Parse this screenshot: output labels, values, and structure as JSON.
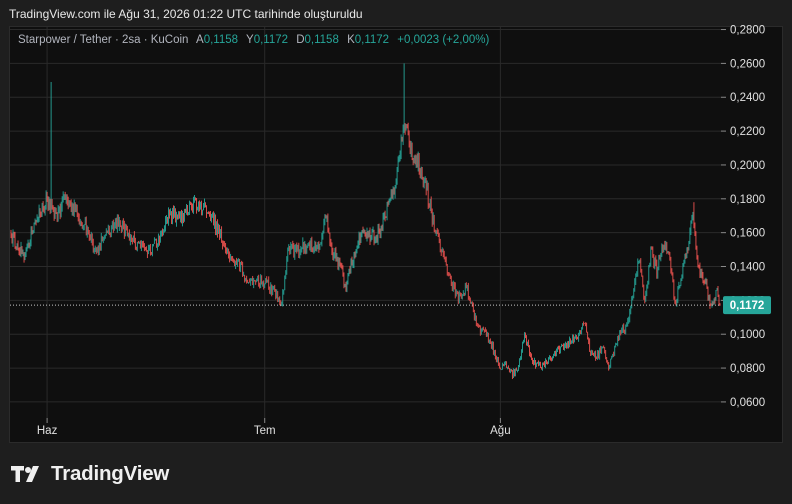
{
  "header": {
    "caption": "TradingView.com ile Ağu 31, 2026 01:22 UTC tarihinde oluşturuldu"
  },
  "legend": {
    "symbol": "Starpower / Tether · 2sa · KuCoin",
    "open_label": "A",
    "open_value": "0,1158",
    "high_label": "Y",
    "high_value": "0,1172",
    "low_label": "D",
    "low_value": "0,1158",
    "close_label": "K",
    "close_value": "0,1172",
    "change": "+0,0023 (+2,00%)"
  },
  "price_label": "0,1172",
  "brand": {
    "name": "TradingView"
  },
  "colors": {
    "up": "#26a69a",
    "down": "#ef5350",
    "background": "#0f0f0f",
    "grid": "#2a2a2a",
    "axis_text": "#e0e0e0"
  },
  "chart_data": {
    "type": "candlestick",
    "interval": "2h",
    "exchange": "KuCoin",
    "y_ticks": [
      "0,0600",
      "0,0800",
      "0,1000",
      "0,1200",
      "0,1400",
      "0,1600",
      "0,1800",
      "0,2000",
      "0,2200",
      "0,2400",
      "0,2600",
      "0,2800"
    ],
    "y_tick_values": [
      0.06,
      0.08,
      0.1,
      0.12,
      0.14,
      0.16,
      0.18,
      0.2,
      0.22,
      0.24,
      0.26,
      0.28
    ],
    "ylim": [
      0.0505,
      0.2815
    ],
    "x_tick_labels": [
      "Haz",
      "Tem",
      "Ağu"
    ],
    "x_tick_indices": [
      36,
      253,
      488
    ],
    "x_count": 708,
    "last_price": 0.1172,
    "grid": true,
    "price_keypoints": [
      [
        0,
        0.159
      ],
      [
        8,
        0.15
      ],
      [
        14,
        0.147
      ],
      [
        22,
        0.163
      ],
      [
        30,
        0.172
      ],
      [
        36,
        0.18
      ],
      [
        40,
        0.175
      ],
      [
        46,
        0.168
      ],
      [
        54,
        0.182
      ],
      [
        60,
        0.177
      ],
      [
        68,
        0.168
      ],
      [
        76,
        0.161
      ],
      [
        84,
        0.149
      ],
      [
        92,
        0.156
      ],
      [
        100,
        0.162
      ],
      [
        108,
        0.166
      ],
      [
        116,
        0.159
      ],
      [
        124,
        0.154
      ],
      [
        132,
        0.15
      ],
      [
        140,
        0.15
      ],
      [
        148,
        0.159
      ],
      [
        158,
        0.172
      ],
      [
        166,
        0.168
      ],
      [
        174,
        0.172
      ],
      [
        184,
        0.178
      ],
      [
        192,
        0.174
      ],
      [
        200,
        0.168
      ],
      [
        208,
        0.16
      ],
      [
        218,
        0.148
      ],
      [
        228,
        0.14
      ],
      [
        236,
        0.133
      ],
      [
        246,
        0.131
      ],
      [
        256,
        0.129
      ],
      [
        264,
        0.124
      ],
      [
        270,
        0.118
      ],
      [
        276,
        0.15
      ],
      [
        284,
        0.15
      ],
      [
        292,
        0.152
      ],
      [
        300,
        0.153
      ],
      [
        308,
        0.151
      ],
      [
        314,
        0.172
      ],
      [
        320,
        0.15
      ],
      [
        328,
        0.141
      ],
      [
        334,
        0.128
      ],
      [
        340,
        0.143
      ],
      [
        348,
        0.158
      ],
      [
        356,
        0.159
      ],
      [
        364,
        0.157
      ],
      [
        370,
        0.163
      ],
      [
        376,
        0.176
      ],
      [
        382,
        0.185
      ],
      [
        388,
        0.208
      ],
      [
        394,
        0.228
      ],
      [
        400,
        0.205
      ],
      [
        406,
        0.2
      ],
      [
        414,
        0.186
      ],
      [
        422,
        0.163
      ],
      [
        430,
        0.148
      ],
      [
        438,
        0.133
      ],
      [
        446,
        0.121
      ],
      [
        454,
        0.128
      ],
      [
        462,
        0.111
      ],
      [
        468,
        0.103
      ],
      [
        476,
        0.098
      ],
      [
        482,
        0.089
      ],
      [
        488,
        0.08
      ],
      [
        494,
        0.082
      ],
      [
        500,
        0.076
      ],
      [
        506,
        0.08
      ],
      [
        512,
        0.1
      ],
      [
        518,
        0.087
      ],
      [
        524,
        0.082
      ],
      [
        530,
        0.081
      ],
      [
        538,
        0.086
      ],
      [
        546,
        0.09
      ],
      [
        554,
        0.094
      ],
      [
        560,
        0.097
      ],
      [
        566,
        0.1
      ],
      [
        572,
        0.108
      ],
      [
        578,
        0.088
      ],
      [
        584,
        0.087
      ],
      [
        590,
        0.092
      ],
      [
        596,
        0.081
      ],
      [
        602,
        0.091
      ],
      [
        608,
        0.102
      ],
      [
        614,
        0.104
      ],
      [
        620,
        0.124
      ],
      [
        626,
        0.147
      ],
      [
        632,
        0.117
      ],
      [
        638,
        0.15
      ],
      [
        644,
        0.138
      ],
      [
        650,
        0.154
      ],
      [
        656,
        0.147
      ],
      [
        662,
        0.118
      ],
      [
        668,
        0.135
      ],
      [
        674,
        0.148
      ],
      [
        680,
        0.17
      ],
      [
        686,
        0.137
      ],
      [
        692,
        0.132
      ],
      [
        698,
        0.117
      ],
      [
        704,
        0.124
      ],
      [
        707,
        0.1172
      ]
    ],
    "spikes": [
      {
        "index": 40,
        "high": 0.249
      },
      {
        "index": 392,
        "high": 0.26
      },
      {
        "index": 681,
        "high": 0.178
      }
    ]
  }
}
